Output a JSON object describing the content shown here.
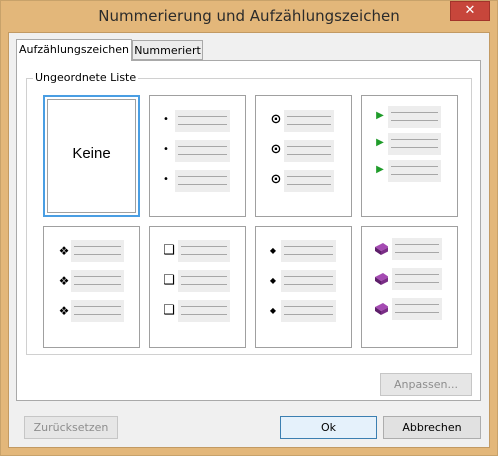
{
  "window": {
    "title": "Nummerierung und Aufzählungszeichen",
    "close_glyph": "✕"
  },
  "tabs": [
    {
      "label": "Aufzählungszeichen",
      "active": true
    },
    {
      "label": "Nummeriert",
      "active": false
    }
  ],
  "group": {
    "label": "Ungeordnete Liste"
  },
  "styles": [
    {
      "label": "Keine",
      "icon": "none",
      "selected": true
    },
    {
      "icon": "small-dot-bullet",
      "glyph": "•"
    },
    {
      "icon": "circled-dot-bullet",
      "glyph": "⊙"
    },
    {
      "icon": "green-triangle-bullet",
      "glyph": "▶",
      "color": "#1f9c2a"
    },
    {
      "icon": "four-diamond-bullet",
      "glyph": "❖"
    },
    {
      "icon": "hollow-square-bullet",
      "glyph": "❑"
    },
    {
      "icon": "small-diamond-bullet",
      "glyph": "◆"
    },
    {
      "icon": "purple-book-bullet",
      "color": "#7a2d86"
    }
  ],
  "buttons": {
    "customize": "Anpassen...",
    "reset": "Zurücksetzen",
    "ok": "Ok",
    "cancel": "Abbrechen"
  }
}
